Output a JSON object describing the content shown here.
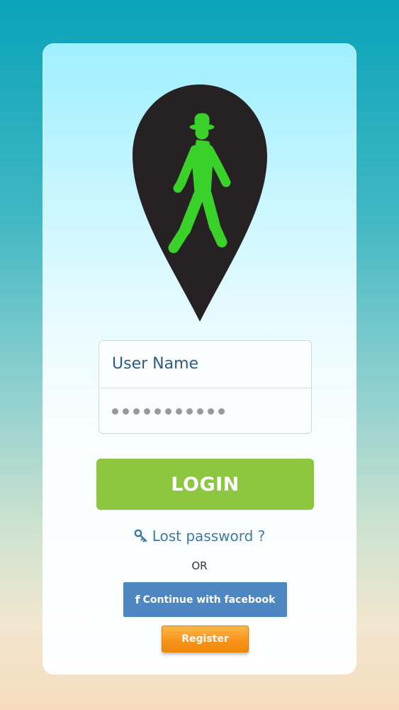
{
  "form": {
    "username_placeholder": "User Name",
    "password_dot_count": 11,
    "login_label": "LOGIN",
    "lost_password_label": "Lost password ?",
    "or_label": "OR",
    "facebook_icon_glyph": "f",
    "facebook_label": "Continue with facebook",
    "register_label": "Register"
  },
  "icons": {
    "logo": "walking-man-location-pin-icon",
    "lost_password": "key-icon",
    "facebook": "facebook-icon"
  },
  "colors": {
    "pin": "#262223",
    "walker": "#3ad12a",
    "login": "#8dc63f",
    "link": "#3d78a6",
    "facebook": "#4e86c1",
    "register": "#f7941d"
  }
}
